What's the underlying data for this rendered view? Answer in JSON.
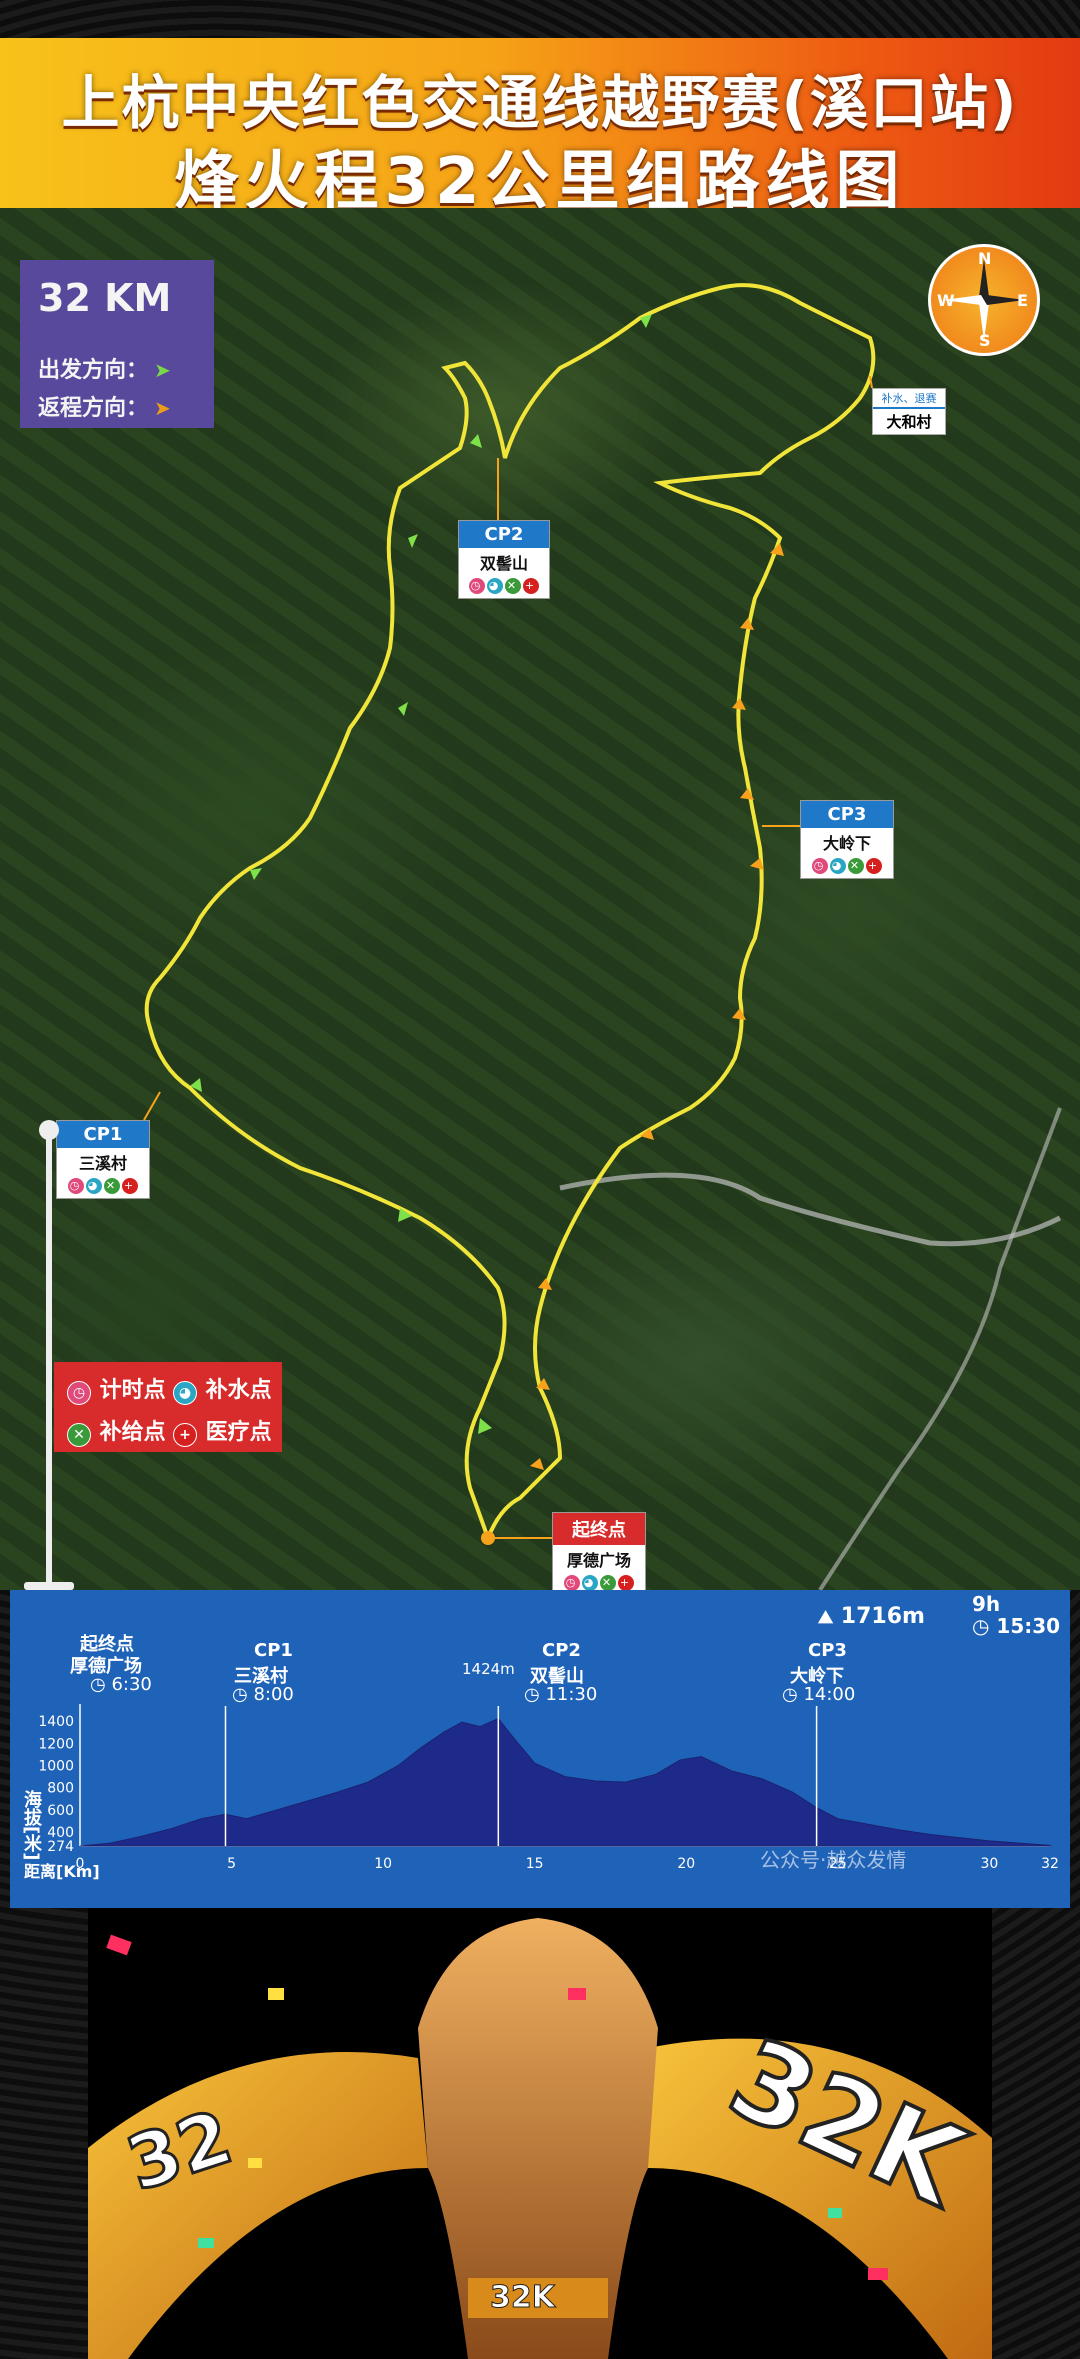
{
  "header": {
    "title_line1": "上杭中央红色交通线越野赛(溪口站)",
    "title_line2": "烽火程32公里组路线图"
  },
  "map": {
    "legend": {
      "distance": "32 KM",
      "outbound": "出发方向：",
      "return": "返程方向："
    },
    "compass": {
      "n": "N",
      "s": "S",
      "e": "E",
      "w": "W"
    },
    "checkpoints": [
      {
        "id": "CP1",
        "name": "三溪村",
        "color": "#1f78c8"
      },
      {
        "id": "CP2",
        "name": "双髻山",
        "color": "#1f78c8"
      },
      {
        "id": "CP3",
        "name": "大岭下",
        "color": "#1f78c8"
      },
      {
        "id": "起终点",
        "name": "厚德广场",
        "color": "#d82b2b"
      }
    ],
    "supply_point": {
      "top": "补水、退赛",
      "name": "大和村"
    },
    "point_legend": {
      "timing": "计时点",
      "water": "补水点",
      "food": "补给点",
      "medical": "医疗点"
    }
  },
  "profile": {
    "elevation_gain": "1716m",
    "time_limit_top": "9h",
    "time_limit_bottom": "15:30",
    "start_label_1": "起终点",
    "start_label_2": "厚德广场",
    "start_time": "6:30",
    "cp1_name": "CP1",
    "cp1_place": "三溪村",
    "cp1_time": "8:00",
    "cp2_name": "CP2",
    "cp2_place": "双髻山",
    "cp2_time": "11:30",
    "cp3_name": "CP3",
    "cp3_place": "大岭下",
    "cp3_time": "14:00",
    "peak_label": "1424m",
    "y_axis_title": "海拔[米]",
    "x_axis_title": "距离[Km]",
    "watermark": "公众号·越众发情"
  },
  "art": {
    "ribbon_text_left": "32",
    "ribbon_text_right": "32K",
    "wrist_text": "32K"
  },
  "chart_data": {
    "type": "area",
    "title": "",
    "xlabel": "距离[Km]",
    "ylabel": "海拔[米]",
    "xlim": [
      0,
      32
    ],
    "ylim": [
      274,
      1500
    ],
    "x_ticks": [
      0,
      5,
      10,
      15,
      20,
      25,
      30,
      32
    ],
    "y_ticks": [
      274,
      400,
      600,
      800,
      1000,
      1200,
      1400
    ],
    "series": [
      {
        "x": [
          0,
          1,
          2,
          3,
          4,
          4.8,
          5.5,
          6.5,
          7.5,
          8.5,
          9.5,
          10.5,
          11.2,
          12,
          12.6,
          13.2,
          13.8,
          14.3,
          15,
          16,
          17,
          18,
          19,
          19.8,
          20.5,
          21.5,
          22.5,
          23.5,
          24.3,
          25,
          26,
          27,
          28,
          29,
          30,
          31,
          32
        ],
        "y": [
          274,
          300,
          360,
          430,
          520,
          560,
          520,
          600,
          680,
          760,
          850,
          1000,
          1150,
          1300,
          1390,
          1350,
          1424,
          1250,
          1020,
          900,
          860,
          850,
          920,
          1050,
          1080,
          950,
          880,
          760,
          620,
          520,
          470,
          420,
          380,
          350,
          320,
          300,
          280
        ]
      }
    ]
  }
}
